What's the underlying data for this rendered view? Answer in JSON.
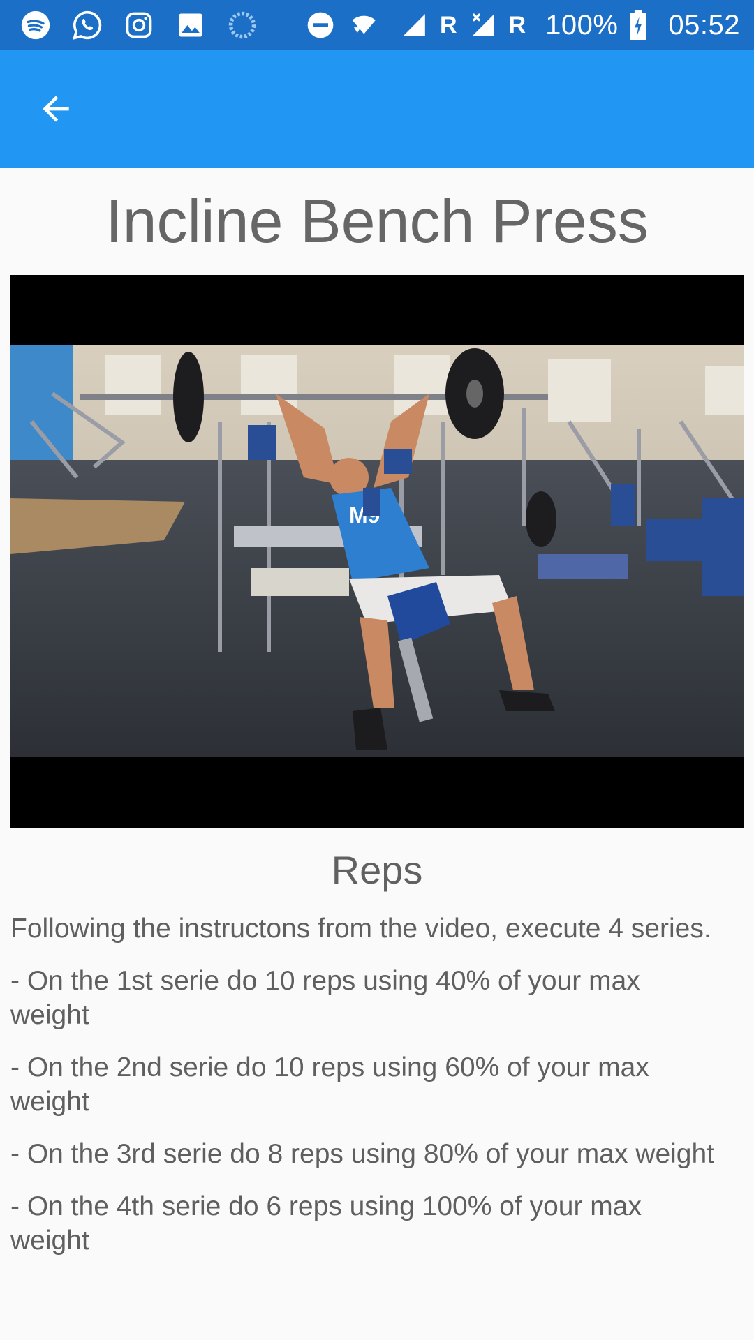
{
  "status_bar": {
    "left_icons": [
      "spotify-icon",
      "whatsapp-icon",
      "instagram-icon",
      "gallery-icon",
      "sync-icon"
    ],
    "right_icons": [
      "do-not-disturb-icon",
      "wifi-icon",
      "signal-icon",
      "signal-no-data-icon",
      "battery-charging-icon"
    ],
    "roaming_label_1": "R",
    "roaming_label_2": "R",
    "battery": "100%",
    "time": "05:52"
  },
  "app_bar": {
    "back_icon": "arrow-back-icon",
    "color": "#2196f3"
  },
  "exercise": {
    "title": "Incline Bench Press"
  },
  "reps": {
    "heading": "Reps",
    "intro": "Following the instructons from the video, execute 4 series.",
    "series": [
      "- On the 1st serie do 10 reps using 40% of your max weight",
      "- On the 2nd serie do 10 reps using 60% of your max weight",
      "- On the 3rd serie do 8 reps using 80% of your max weight",
      "- On the 4th serie do 6 reps using 100% of your max weight"
    ]
  },
  "colors": {
    "status_bar": "#1b6fc7",
    "app_bar": "#2196f3",
    "background": "#fafafa",
    "text": "#5f5f5f"
  }
}
